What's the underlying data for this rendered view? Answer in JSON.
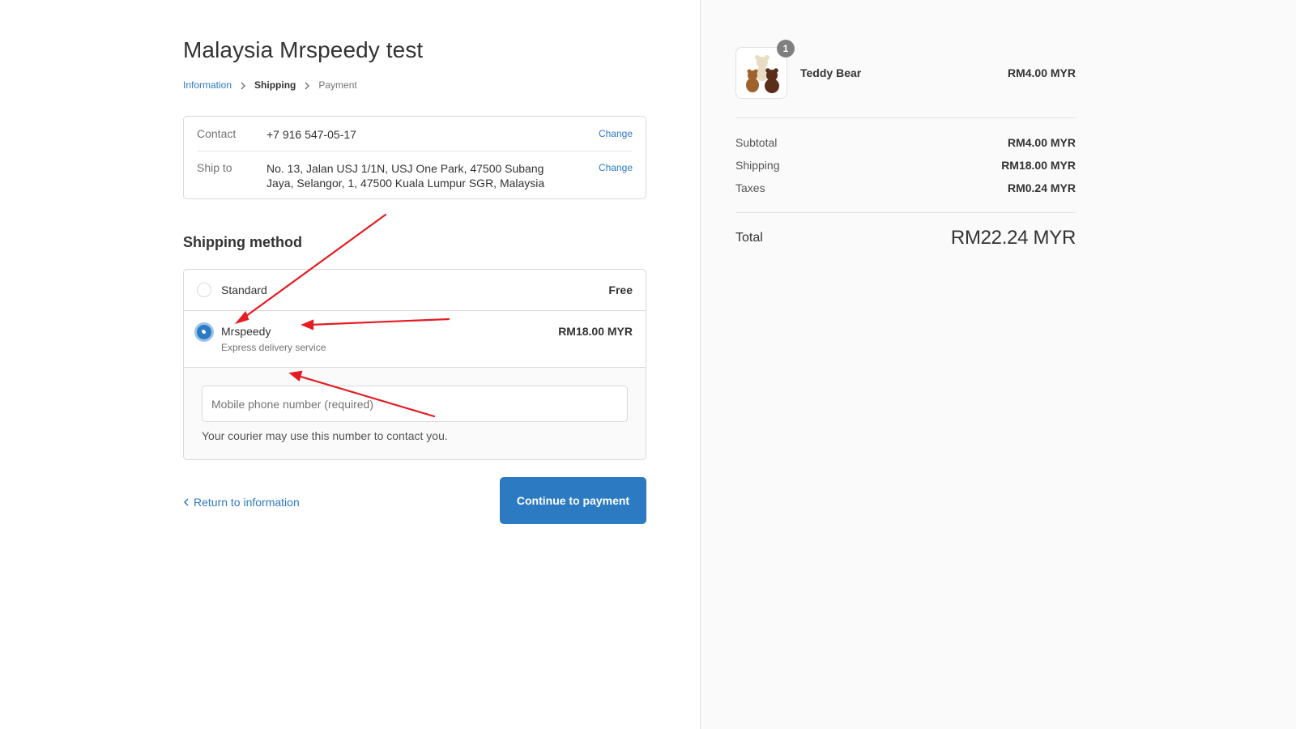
{
  "shop": {
    "title": "Malaysia Mrspeedy test"
  },
  "breadcrumb": {
    "items": [
      "Information",
      "Shipping",
      "Payment"
    ]
  },
  "review": {
    "contact": {
      "label": "Contact",
      "value": "+7 916 547-05-17",
      "action": "Change"
    },
    "ship_to": {
      "label": "Ship to",
      "value": "No. 13, Jalan USJ 1/1N, USJ One Park, 47500 Subang Jaya, Selangor, 1, 47500 Kuala Lumpur SGR, Malaysia",
      "action": "Change"
    }
  },
  "shipping_method": {
    "title": "Shipping method",
    "options": [
      {
        "name": "Standard",
        "price": "Free",
        "selected": false
      },
      {
        "name": "Mrspeedy",
        "subtitle": "Express delivery service",
        "price": "RM18.00 MYR",
        "selected": true
      }
    ],
    "phone": {
      "placeholder": "Mobile phone number (required)",
      "value": "",
      "help": "Your courier may use this number to contact you."
    }
  },
  "actions": {
    "return_label": "Return to information",
    "continue_label": "Continue to payment"
  },
  "order": {
    "product": {
      "name": "Teddy Bear",
      "price": "RM4.00 MYR",
      "quantity": "1",
      "image_icon": "teddy-bear-image"
    },
    "subtotal": {
      "label": "Subtotal",
      "value": "RM4.00 MYR"
    },
    "shipping": {
      "label": "Shipping",
      "value": "RM18.00 MYR"
    },
    "taxes": {
      "label": "Taxes",
      "value": "RM0.24 MYR"
    },
    "total": {
      "label": "Total",
      "value": "RM22.24 MYR"
    }
  },
  "colors": {
    "accent": "#2c7ac2",
    "annotation": "#e51c23",
    "sidebar_bg": "#fafafa"
  }
}
